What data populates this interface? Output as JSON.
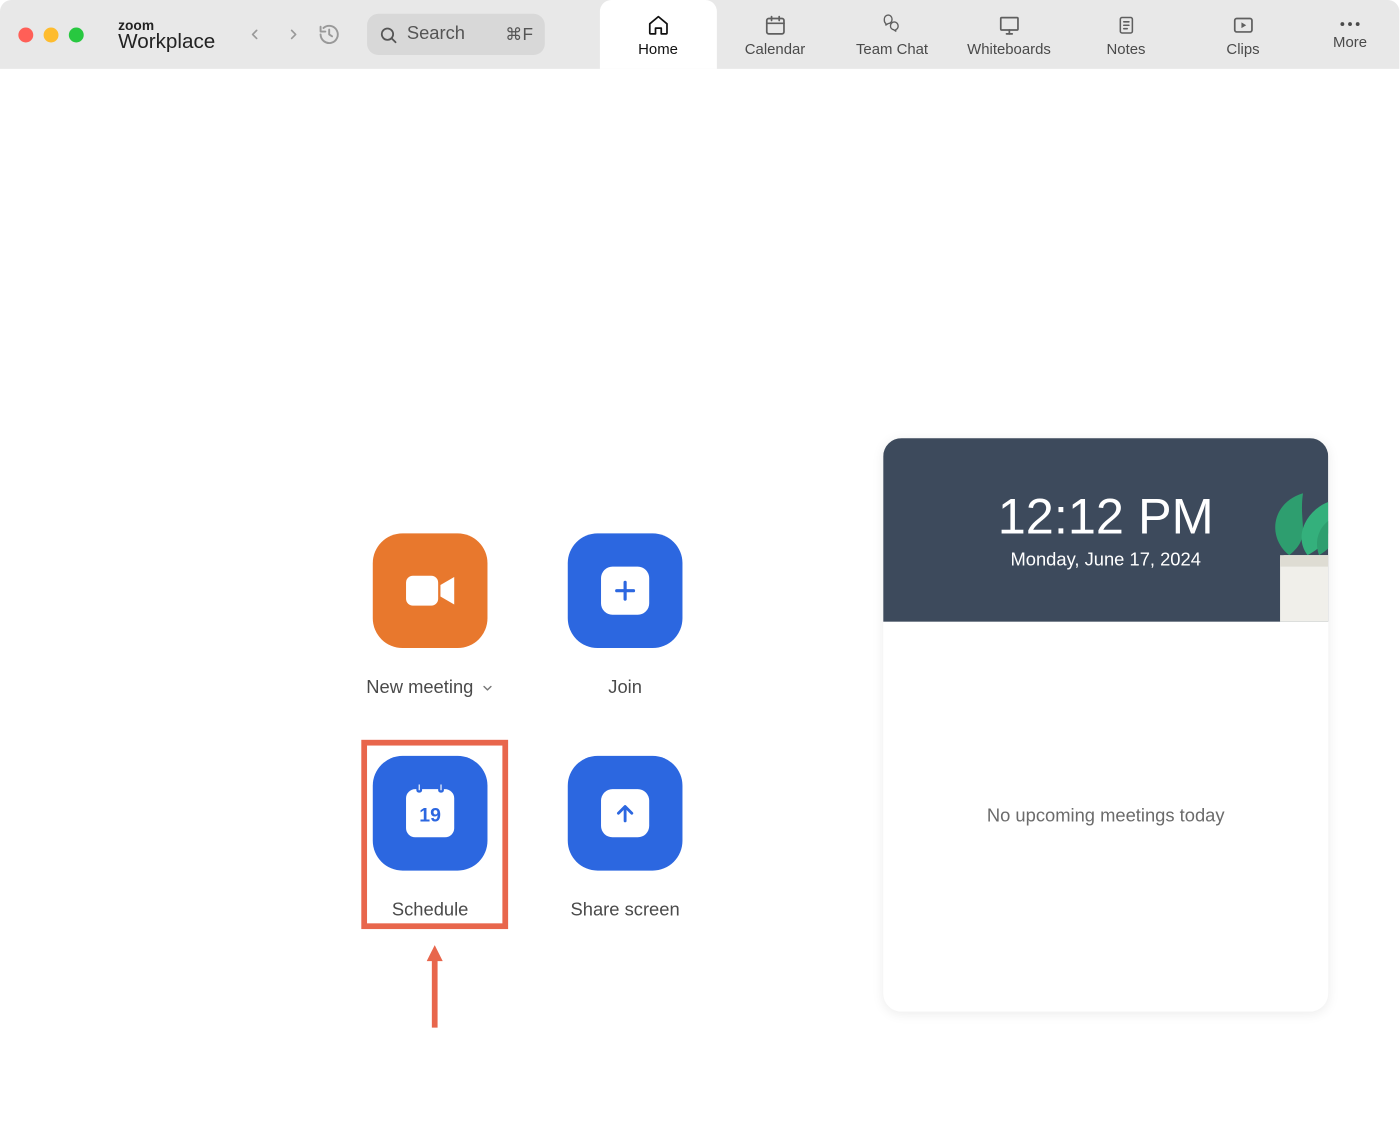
{
  "brand": {
    "top": "zoom",
    "bottom": "Workplace"
  },
  "search": {
    "placeholder": "Search",
    "shortcut": "⌘F"
  },
  "tabs": [
    {
      "label": "Home"
    },
    {
      "label": "Calendar"
    },
    {
      "label": "Team Chat"
    },
    {
      "label": "Whiteboards"
    },
    {
      "label": "Notes"
    },
    {
      "label": "Clips"
    }
  ],
  "more_label": "More",
  "actions": {
    "new_meeting": "New meeting",
    "join": "Join",
    "schedule": "Schedule",
    "schedule_day": "19",
    "share_screen": "Share screen"
  },
  "calendar": {
    "time": "12:12 PM",
    "date": "Monday, June 17, 2024",
    "empty_state": "No upcoming meetings today"
  }
}
